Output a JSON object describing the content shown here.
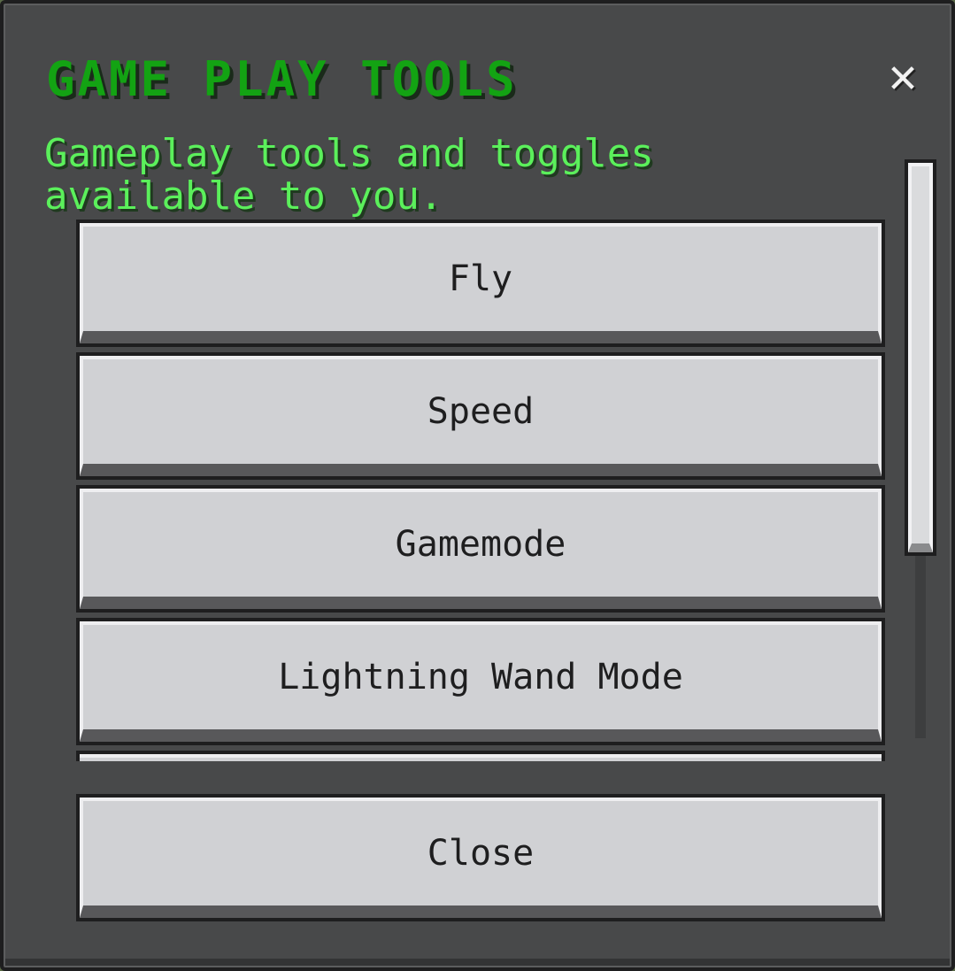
{
  "dialog": {
    "title": "GAME PLAY TOOLS",
    "close_glyph": "✕",
    "subtitle": "Gameplay tools and toggles available to you."
  },
  "tools": [
    {
      "label": "Fly"
    },
    {
      "label": "Speed"
    },
    {
      "label": "Gamemode"
    },
    {
      "label": "Lightning Wand Mode"
    }
  ],
  "footer": {
    "close_label": "Close"
  },
  "icons": {
    "close": "close-icon"
  },
  "colors": {
    "title": "#13a313",
    "subtitle": "#5bf05b",
    "panel": "#48494a",
    "button_face": "#d0d1d4",
    "button_text": "#1e1e1f"
  }
}
